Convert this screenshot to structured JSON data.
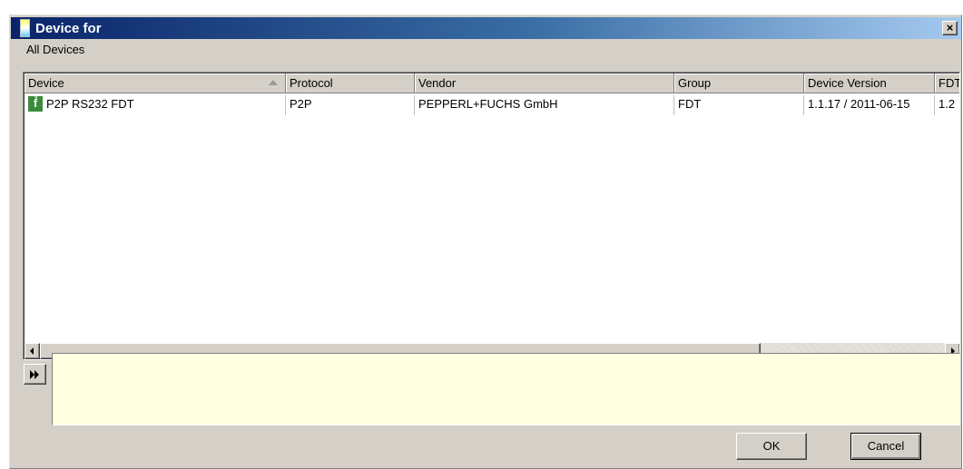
{
  "window": {
    "title": "Device for",
    "close_glyph": "×"
  },
  "tab": {
    "label": "All Devices"
  },
  "table": {
    "columns": [
      "Device",
      "Protocol",
      "Vendor",
      "Group",
      "Device Version",
      "FDT"
    ],
    "sorted_column": "Device",
    "sort_direction": "ascending",
    "rows": [
      {
        "device": "P2P RS232 FDT",
        "device_icon": "pepperl-fuchs-device-icon",
        "protocol": "P2P",
        "vendor": "PEPPERL+FUCHS GmbH",
        "group": "FDT",
        "device_version": "1.1.17 / 2011-06-15",
        "fdt": "1.2"
      }
    ]
  },
  "icons": {
    "device_icon_glyph": "f̊",
    "device_icon_color": "#3c8a3c"
  },
  "buttons": {
    "ok": "OK",
    "cancel": "Cancel"
  },
  "colors": {
    "titlebar_start": "#0a246a",
    "titlebar_end": "#a6caf0",
    "info_panel_bg": "#ffffe1",
    "dialog_bg": "#d4d0c8"
  }
}
